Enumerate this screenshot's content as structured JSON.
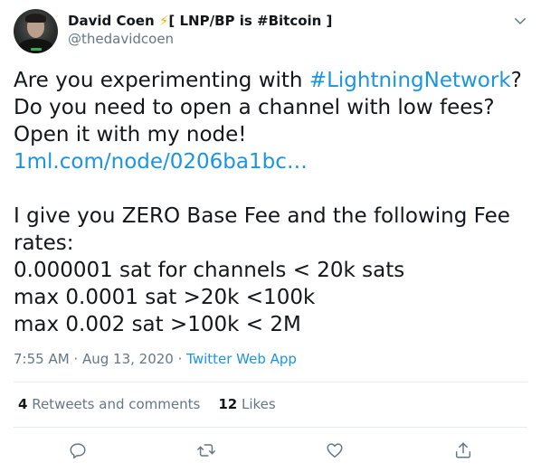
{
  "author": {
    "name": "David Coen",
    "name_bolt": "⚡",
    "name_suffix": "[ LNP/BP is #Bitcoin ]",
    "handle": "@thedavidcoen"
  },
  "tweet": {
    "line1_text": "Are you experimenting with ",
    "line1_hashtag": "#LightningNetwork",
    "line1_end": "?",
    "line2": "Do you need to open a channel with low fees?",
    "line3": "Open it with my node!",
    "link": "1ml.com/node/0206ba1bc…",
    "line5": "I give you ZERO Base Fee and the following Fee",
    "line6": "rates:",
    "line7": "0.000001 sat for channels < 20k sats",
    "line8": "max 0.0001 sat >20k <100k",
    "line9": "max 0.002 sat >100k < 2M"
  },
  "meta": {
    "time": "7:55 AM",
    "separator": " · ",
    "date": "Aug 13, 2020",
    "source": "Twitter Web App"
  },
  "stats": {
    "retweets_count": "4",
    "retweets_label": " Retweets and comments",
    "likes_count": "12",
    "likes_label": " Likes"
  },
  "actions": {
    "reply_icon": "reply-icon",
    "retweet_icon": "retweet-icon",
    "like_icon": "like-icon",
    "share_icon": "share-icon"
  },
  "colors": {
    "link": "#1b95e0",
    "secondary_text": "#657786",
    "primary_text": "#14171a",
    "divider": "#e6ecf0"
  }
}
